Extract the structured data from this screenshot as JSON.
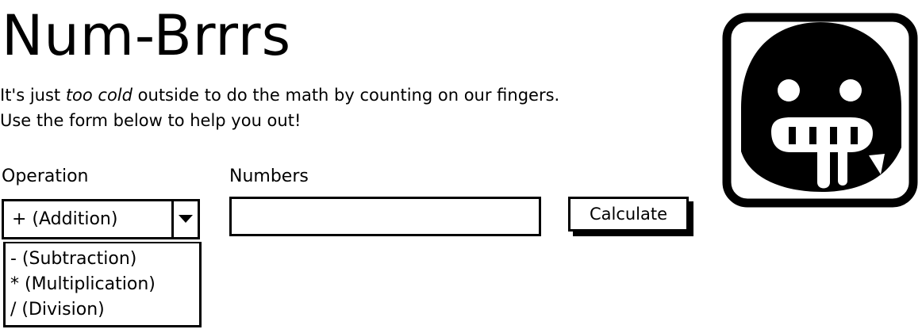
{
  "app": {
    "title": "Num-Brrrs"
  },
  "intro": {
    "line1_before": "It's just ",
    "line1_emphasis": "too cold",
    "line1_after": " outside to do the math by counting on our fingers.",
    "line2": "Use the form below to help you out!"
  },
  "form": {
    "operation_label": "Operation",
    "numbers_label": "Numbers",
    "operation_selected": "+ (Addition)",
    "operation_options": [
      "- (Subtraction)",
      "* (Multiplication)",
      "/ (Division)"
    ],
    "numbers_value": "",
    "calculate_label": "Calculate"
  },
  "icons": {
    "select_arrow": "chevron-down-icon",
    "mascot": "frozen-ghost-icon"
  },
  "colors": {
    "ink": "#000000",
    "background": "#ffffff"
  }
}
